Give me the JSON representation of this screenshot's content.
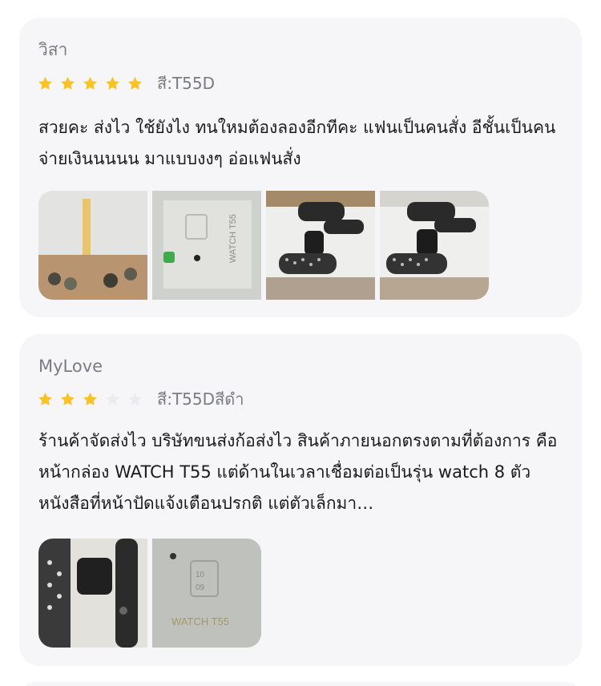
{
  "reviews": [
    {
      "name": "วิสา",
      "rating": 5,
      "max_rating": 5,
      "variant": "สี:T55D",
      "text": "สวยคะ ส่งไว ใช้ยังไง ทนใหมต้องลองอีกทีคะ แฟนเป็นคนสั่ง อีชั้นเป็นคนจ่ายเงินนนนน มาแบบงงๆ อ่อแฟนสั่ง",
      "photos": [
        "photo-packaging",
        "photo-watch-box",
        "photo-watch-straps",
        "photo-watch-straps-2"
      ]
    },
    {
      "name": "MyLove",
      "rating": 3,
      "max_rating": 5,
      "variant": "สี:T55Dสีดำ",
      "text": "ร้านค้าจัดส่งไว บริษัทขนส่งก้อส่งไว สินค้าภายนอกตรงตามที่ต้องการ คือหน้ากล่อง WATCH T55 แต่ด้านในเวลาเชื่อมต่อเป็นรุ่น watch 8 ตัวหนังสือที่หน้าปัดแจ้งเตือนปรกติ แต่ตัวเล็กมา…",
      "photos": [
        "photo-watch-straps",
        "photo-watch-box-label"
      ]
    }
  ],
  "colors": {
    "star_filled": "#f7c325",
    "star_empty": "#ececf0",
    "card_bg": "#f6f6f8",
    "muted_text": "#7b7b85"
  }
}
